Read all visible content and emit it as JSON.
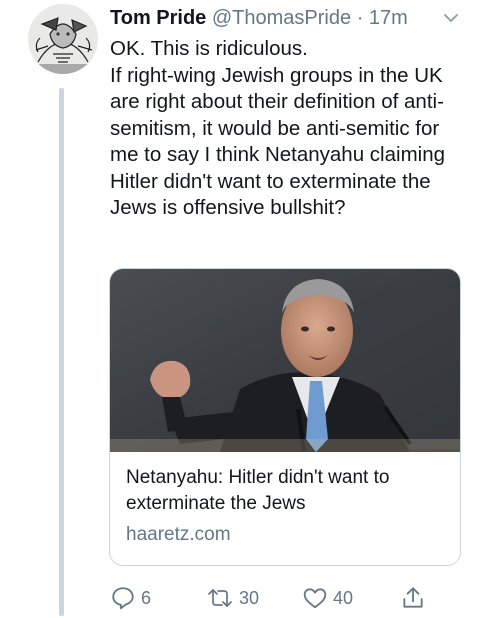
{
  "tweet": {
    "author_name": "Tom Pride",
    "author_handle": "@ThomasPride",
    "separator": "·",
    "time": "17m",
    "text_lines": [
      "OK. This is ridiculous.",
      "If right-wing Jewish groups in the UK are right about their definition of anti-semitism, it would be anti-semitic for me to say I think Netanyahu claiming Hitler didn't want to exterminate the Jews is offensive bullshit?"
    ]
  },
  "card": {
    "title": "Netanyahu: Hitler didn't want to exterminate the Jews",
    "domain": "haaretz.com"
  },
  "actions": {
    "replies": "6",
    "retweets": "30",
    "likes": "40"
  },
  "colors": {
    "text": "#14171a",
    "secondary": "#657786",
    "border": "#ccd6dd"
  },
  "icons": [
    "reply-icon",
    "retweet-icon",
    "like-icon",
    "share-icon",
    "chevron-down-icon"
  ]
}
